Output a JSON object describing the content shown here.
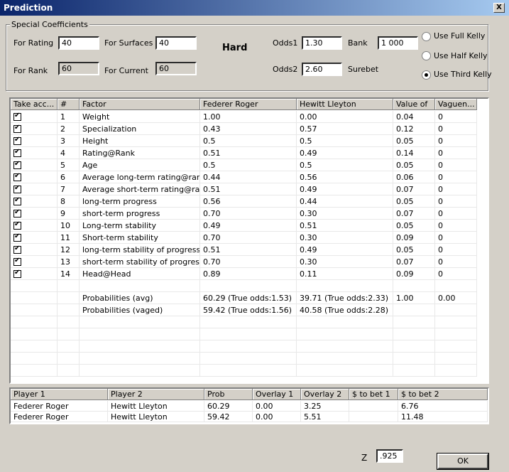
{
  "window": {
    "title": "Prediction",
    "close_label": "X"
  },
  "coeffs": {
    "group_label": "Special Coefficients",
    "rating_label": "For Rating",
    "rating_value": "40",
    "surfaces_label": "For Surfaces",
    "surfaces_value": "40",
    "rank_label": "For Rank",
    "rank_value": "60",
    "current_label": "For Current",
    "current_value": "60",
    "surface": "Hard",
    "odds1_label": "Odds1",
    "odds1_value": "1.30",
    "odds2_label": "Odds2",
    "odds2_value": "2.60",
    "bank_label": "Bank",
    "bank_value": "1 000",
    "surebet_label": "Surebet",
    "kelly_full": "Use Full Kelly",
    "kelly_half": "Use Half Kelly",
    "kelly_third": "Use Third Kelly",
    "kelly_selected": "third"
  },
  "factors": {
    "headers": [
      "Take acc...",
      "#",
      "Factor",
      "Federer Roger",
      "Hewitt Lleyton",
      "Value of",
      "Vaguen..."
    ],
    "rows": [
      [
        "1",
        "Weight",
        "1.00",
        "0.00",
        "0.04",
        "0"
      ],
      [
        "2",
        "Specialization",
        "0.43",
        "0.57",
        "0.12",
        "0"
      ],
      [
        "3",
        "Height",
        "0.5",
        "0.5",
        "0.05",
        "0"
      ],
      [
        "4",
        "Rating@Rank",
        "0.51",
        "0.49",
        "0.14",
        "0"
      ],
      [
        "5",
        "Age",
        "0.5",
        "0.5",
        "0.05",
        "0"
      ],
      [
        "6",
        "Average long-term rating@rank",
        "0.44",
        "0.56",
        "0.06",
        "0"
      ],
      [
        "7",
        "Average short-term rating@rank",
        "0.51",
        "0.49",
        "0.07",
        "0"
      ],
      [
        "8",
        "long-term progress",
        "0.56",
        "0.44",
        "0.05",
        "0"
      ],
      [
        "9",
        "short-term progress",
        "0.70",
        "0.30",
        "0.07",
        "0"
      ],
      [
        "10",
        "Long-term stability",
        "0.49",
        "0.51",
        "0.05",
        "0"
      ],
      [
        "11",
        "Short-term stability",
        "0.70",
        "0.30",
        "0.09",
        "0"
      ],
      [
        "12",
        "long-term stability of progress/re...",
        "0.51",
        "0.49",
        "0.05",
        "0"
      ],
      [
        "13",
        "short-term stability of progress/r...",
        "0.70",
        "0.30",
        "0.07",
        "0"
      ],
      [
        "14",
        "Head@Head",
        "0.89",
        "0.11",
        "0.09",
        "0"
      ]
    ],
    "summary": [
      [
        "Probabilities (avg)",
        "60.29 (True odds:1.53)",
        "39.71 (True odds:2.33)",
        "1.00",
        "0.00"
      ],
      [
        "Probabilities (vaged)",
        "59.42 (True odds:1.56)",
        "40.58 (True odds:2.28)",
        "",
        ""
      ]
    ]
  },
  "bets": {
    "headers": [
      "Player 1",
      "Player 2",
      "Prob",
      "Overlay 1",
      "Overlay 2",
      "$ to bet 1",
      "$ to bet 2"
    ],
    "rows": [
      [
        "Federer Roger",
        "Hewitt Lleyton",
        "60.29",
        "0.00",
        "3.25",
        "",
        "6.76"
      ],
      [
        "Federer Roger",
        "Hewitt Lleyton",
        "59.42",
        "0.00",
        "5.51",
        "",
        "11.48"
      ]
    ]
  },
  "footer": {
    "z_label": "Z",
    "z_value": ".925",
    "ok_label": "OK"
  }
}
